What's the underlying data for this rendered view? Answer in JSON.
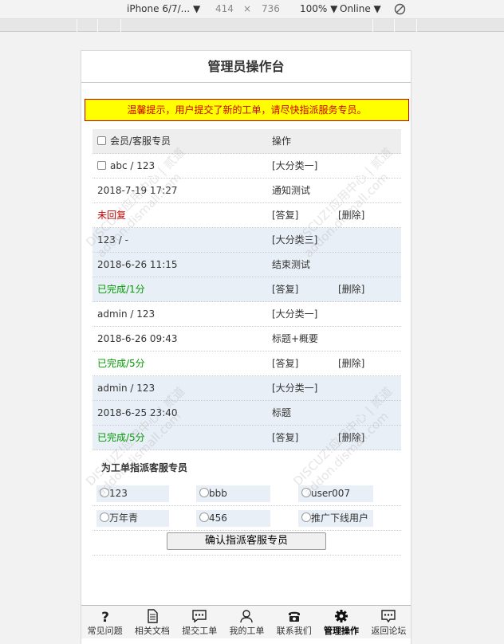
{
  "devtools": {
    "device": "iPhone 6/7/...",
    "width": "414",
    "times": "×",
    "height": "736",
    "zoom": "100%",
    "network": "Online"
  },
  "header": {
    "title": "管理员操作台"
  },
  "notice": "温馨提示，用户提交了新的工单，请尽快指派服务专员。",
  "table": {
    "head": {
      "col1": "会员/客服专员",
      "col2": "操作"
    },
    "tickets": [
      {
        "users": "abc / 123",
        "category": "[大分类一]",
        "time": "2018-7-19 17:27",
        "title": "通知测试",
        "status": "未回复",
        "reply": "[答复]",
        "delete": "[删除]"
      },
      {
        "users": "123 / -",
        "category": "[大分类三]",
        "time": "2018-6-26 11:15",
        "title": "结束测试",
        "status": "已完成/1分",
        "reply": "[答复]",
        "delete": "[删除]"
      },
      {
        "users": "admin / 123",
        "category": "[大分类一]",
        "time": "2018-6-26 09:43",
        "title": "标题+概要",
        "status": "已完成/5分",
        "reply": "[答复]",
        "delete": "[删除]"
      },
      {
        "users": "admin / 123",
        "category": "[大分类一]",
        "time": "2018-6-25 23:40",
        "title": "标题",
        "status": "已完成/5分",
        "reply": "[答复]",
        "delete": "[删除]"
      }
    ]
  },
  "assign": {
    "title": "为工单指派客服专员",
    "options": [
      "123",
      "bbb",
      "user007",
      "万年青",
      "456",
      "推广下线用户"
    ],
    "confirm": "确认指派客服专员"
  },
  "nav": [
    {
      "label": "常见问题",
      "icon": "question-icon"
    },
    {
      "label": "相关文档",
      "icon": "document-icon"
    },
    {
      "label": "提交工单",
      "icon": "chat-bubble-icon"
    },
    {
      "label": "我的工单",
      "icon": "user-icon"
    },
    {
      "label": "联系我们",
      "icon": "phone-icon"
    },
    {
      "label": "管理操作",
      "icon": "gear-icon"
    },
    {
      "label": "返回论坛",
      "icon": "forum-bubble-icon"
    }
  ],
  "watermark": [
    "DISCUZ!应用中心 | 贰道",
    "addon.dismall.com"
  ],
  "colors": {
    "notice_bg": "#ffff00",
    "notice_text": "#cc0000",
    "unreplied": "#cc0000",
    "completed": "#009900",
    "alt_row": "#e8eff6"
  }
}
